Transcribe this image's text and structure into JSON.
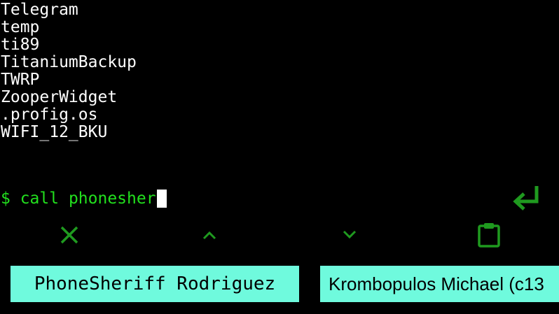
{
  "terminal": {
    "output_lines": [
      "Telegram",
      "temp",
      "ti89",
      "TitaniumBackup",
      "TWRP",
      "ZooperWidget",
      ".profig.os",
      "WIFI_12_BKU"
    ],
    "prompt": "$ ",
    "command": "call phonesher"
  },
  "actions": {
    "enter_icon": "enter-return-icon",
    "clear_icon": "close-icon",
    "history_up_icon": "chevron-up-icon",
    "history_down_icon": "chevron-down-icon",
    "paste_icon": "clipboard-icon"
  },
  "suggestions": [
    "PhoneSheriff Rodriguez",
    "Krombopulos Michael (c13"
  ],
  "colors": {
    "background": "#000000",
    "output_text": "#ffffff",
    "prompt_text": "#22e01e",
    "icon": "#1f9a1f",
    "suggestion_bg": "#6ffadd"
  }
}
